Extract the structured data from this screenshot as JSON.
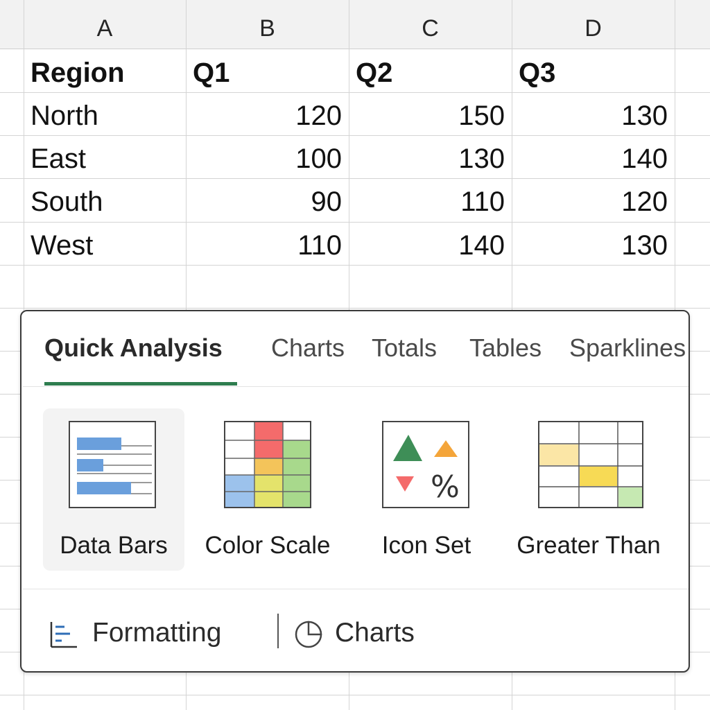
{
  "columns": [
    "A",
    "B",
    "C",
    "D"
  ],
  "header_row": [
    "Region",
    "Q1",
    "Q2",
    "Q3"
  ],
  "rows": [
    {
      "region": "North",
      "q1": "120",
      "q2": "150",
      "q3": "130"
    },
    {
      "region": "East",
      "q1": "100",
      "q2": "130",
      "q3": "140"
    },
    {
      "region": "South",
      "q1": "90",
      "q2": "110",
      "q3": "120"
    },
    {
      "region": "West",
      "q1": "110",
      "q2": "140",
      "q3": "130"
    }
  ],
  "quick_analysis": {
    "tabs": [
      {
        "label": "Quick Analysis",
        "active": true
      },
      {
        "label": "Charts"
      },
      {
        "label": "Totals"
      },
      {
        "label": "Tables"
      },
      {
        "label": "Sparklines"
      }
    ],
    "options": [
      {
        "label": "Data Bars",
        "icon": "data-bars-icon",
        "selected": true
      },
      {
        "label": "Color Scale",
        "icon": "color-scale-icon"
      },
      {
        "label": "Icon Set",
        "icon": "icon-set-icon"
      },
      {
        "label": "Greater Than",
        "icon": "greater-than-icon"
      }
    ],
    "footer": [
      {
        "label": "Formatting",
        "icon": "formatting-icon"
      },
      {
        "label": "Charts",
        "icon": "pie-chart-icon"
      }
    ]
  },
  "colors": {
    "accent": "#2e7d4f",
    "bar_blue": "#6a9fdc",
    "red": "#f46b6b",
    "yellow": "#f4d35e",
    "green": "#a8d98c",
    "icon_green": "#3e8e57",
    "icon_orange": "#f4a53a"
  }
}
